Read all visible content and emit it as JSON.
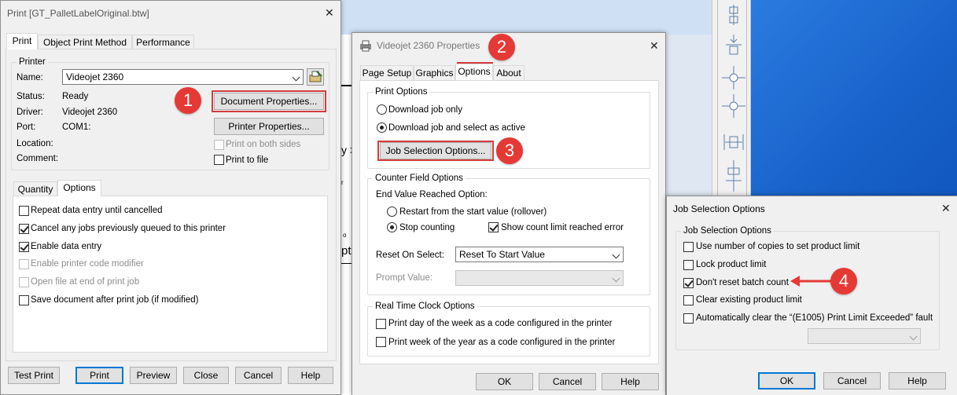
{
  "background": {
    "fragment_1": "y >",
    "fragment_2": "pt",
    "fragment_3": "o",
    "fragment_4": "r"
  },
  "print_dialog": {
    "title": "Print [GT_PalletLabelOriginal.btw]",
    "tabs": [
      "Print",
      "Object Print Method",
      "Performance"
    ],
    "printer_group": "Printer",
    "name_label": "Name:",
    "name_value": "Videojet 2360",
    "status_label": "Status:",
    "status_value": "Ready",
    "driver_label": "Driver:",
    "driver_value": "Videojet 2360",
    "port_label": "Port:",
    "port_value": "COM1:",
    "location_label": "Location:",
    "comment_label": "Comment:",
    "document_properties": "Document Properties...",
    "printer_properties": "Printer Properties...",
    "print_both_sides": "Print on both sides",
    "print_to_file": "Print to file",
    "sub_tabs": [
      "Quantity",
      "Options"
    ],
    "options": [
      {
        "label": "Repeat data entry until cancelled",
        "checked": false,
        "disabled": false
      },
      {
        "label": "Cancel any jobs previously queued to this printer",
        "checked": true,
        "disabled": false
      },
      {
        "label": "Enable data entry",
        "checked": true,
        "disabled": false
      },
      {
        "label": "Enable printer code modifier",
        "checked": false,
        "disabled": true
      },
      {
        "label": "Open file at end of print job",
        "checked": false,
        "disabled": true
      },
      {
        "label": "Save document after print job (if modified)",
        "checked": false,
        "disabled": false
      }
    ],
    "buttons": [
      "Test Print",
      "Print",
      "Preview",
      "Close",
      "Cancel",
      "Help"
    ]
  },
  "properties_dialog": {
    "title": "Videojet 2360 Properties",
    "tabs": [
      "Page Setup",
      "Graphics",
      "Options",
      "About"
    ],
    "print_options_group": "Print Options",
    "download_only": "Download job only",
    "download_select": "Download job and select as active",
    "job_selection_button": "Job Selection Options...",
    "counter_group": "Counter Field Options",
    "end_value_label": "End Value Reached Option:",
    "restart_label": "Restart from the start value (rollover)",
    "stop_label": "Stop counting",
    "show_count_label": "Show count limit reached error",
    "reset_on_select_label": "Reset On Select:",
    "reset_on_select_value": "Reset To Start Value",
    "prompt_value_label": "Prompt Value:",
    "rtc_group": "Real Time Clock Options",
    "rtc_day": "Print day of the week as a code configured in the printer",
    "rtc_week": "Print week of the year as a code configured in the printer",
    "buttons": [
      "OK",
      "Cancel",
      "Help"
    ]
  },
  "job_selection_dialog": {
    "title": "Job Selection Options",
    "group": "Job Selection Options",
    "options": [
      {
        "label": "Use number of copies to set product limit",
        "checked": false
      },
      {
        "label": "Lock product limit",
        "checked": false
      },
      {
        "label": "Don't reset batch count",
        "checked": true
      },
      {
        "label": "Clear existing product limit",
        "checked": false
      },
      {
        "label": "Automatically clear the “(E1005) Print Limit Exceeded” fault",
        "checked": false
      }
    ],
    "buttons": [
      "OK",
      "Cancel",
      "Help"
    ]
  },
  "annotations": [
    "1",
    "2",
    "3",
    "4"
  ],
  "colors": {
    "annotation": "#e53935",
    "desktop_blue": "#1b6fd1",
    "dialog_bg": "#f0f0f0"
  }
}
